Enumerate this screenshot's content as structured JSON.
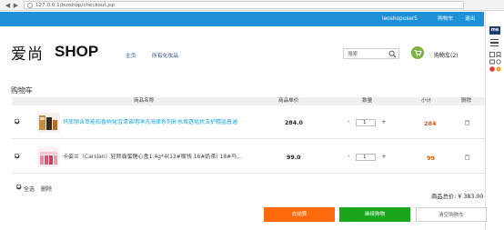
{
  "browser": {
    "url": "127.0.0.1/leoshop/checkout.jsp"
  },
  "topbar": {
    "username": "leoshopuser5",
    "cart": "购物车",
    "logout": "退出"
  },
  "header": {
    "logo_cn": "爱尚",
    "logo_en": "SHOP",
    "nav": [
      "主页",
      "所有化妆品"
    ],
    "search_placeholder": "搜索",
    "cart_label": "购物车(2)"
  },
  "page_title": "购物车",
  "table": {
    "headers": [
      "商品名称",
      "商品单价",
      "数量",
      "小计",
      "删除"
    ],
    "rows": [
      {
        "name": "玛菲丽含萃能桔香树化雪清诺明净洗海律系列补水焕透化状洁护精晶普通",
        "price": "284.0",
        "qty": "1",
        "subtotal": "284",
        "name_color": "#19a4d8",
        "subtotal_color": "#e8590c"
      },
      {
        "name": "卡姿兰（Carslan）轻颜霸蜜糖心盒1.4g*4(13#嗳钱 16#奶茶) 18#鸟...",
        "price": "99.0",
        "qty": "1",
        "subtotal": "99",
        "name_color": "#444444",
        "subtotal_color": "#e8590c"
      }
    ]
  },
  "footer": {
    "select_all": "全选",
    "delete": "删除",
    "total_label": "商品总价: ¥ 383.00"
  },
  "actions": {
    "checkout": "去结算",
    "continue": "继续购物",
    "clear": "清空购物车"
  },
  "colors": {
    "topbar": "#1e90d8",
    "checkout": "#ff6a0c",
    "continue": "#1aa61a",
    "accent": "#e8590c"
  }
}
